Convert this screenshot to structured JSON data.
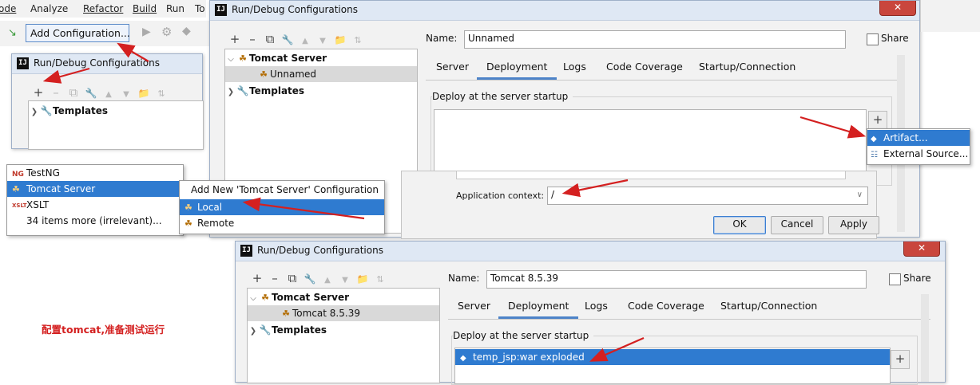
{
  "menubar": {
    "items": [
      "ode",
      "Analyze",
      "Refactor",
      "Build",
      "Run",
      "To"
    ],
    "add_config_label": "Add Configuration..."
  },
  "small_dialog": {
    "title": "Run/Debug Configurations",
    "tree": {
      "templates": "Templates"
    }
  },
  "dialog_top": {
    "title": "Run/Debug Configurations",
    "name_label": "Name:",
    "name_value": "Unnamed",
    "share_label": "Share",
    "tree": {
      "tomcat_server": "Tomcat Server",
      "child": "Unnamed",
      "templates": "Templates"
    },
    "tabs": [
      "Server",
      "Deployment",
      "Logs",
      "Code Coverage",
      "Startup/Connection"
    ],
    "active_tab": "Deployment",
    "deploy_group": "Deploy at the server startup",
    "app_context_label": "Application context:",
    "app_context_value": "/",
    "buttons": {
      "ok": "OK",
      "cancel": "Cancel",
      "apply": "Apply"
    }
  },
  "artifact_menu": {
    "items": [
      "Artifact...",
      "External Source..."
    ]
  },
  "type_list": {
    "items": [
      {
        "icon": "NG",
        "label": "TestNG"
      },
      {
        "icon": "cat",
        "label": "Tomcat Server"
      },
      {
        "icon": "XSLT",
        "label": "XSLT"
      },
      {
        "icon": "",
        "label": "34 items more (irrelevant)..."
      }
    ],
    "selected": "Tomcat Server"
  },
  "add_new_menu": {
    "header": "Add New 'Tomcat Server' Configuration",
    "items": [
      "Local",
      "Remote"
    ],
    "selected": "Local"
  },
  "dialog_bottom": {
    "title": "Run/Debug Configurations",
    "name_label": "Name:",
    "name_value": "Tomcat 8.5.39",
    "share_label": "Share",
    "tree": {
      "tomcat_server": "Tomcat Server",
      "child": "Tomcat 8.5.39",
      "templates": "Templates"
    },
    "tabs": [
      "Server",
      "Deployment",
      "Logs",
      "Code Coverage",
      "Startup/Connection"
    ],
    "active_tab": "Deployment",
    "deploy_group": "Deploy at the server startup",
    "deploy_item": "temp_jsp:war exploded"
  },
  "caption": "配置tomcat,准备测试运行",
  "colors": {
    "accent": "#2f7bd0",
    "arrow": "#d42020",
    "caption": "#d42020"
  }
}
